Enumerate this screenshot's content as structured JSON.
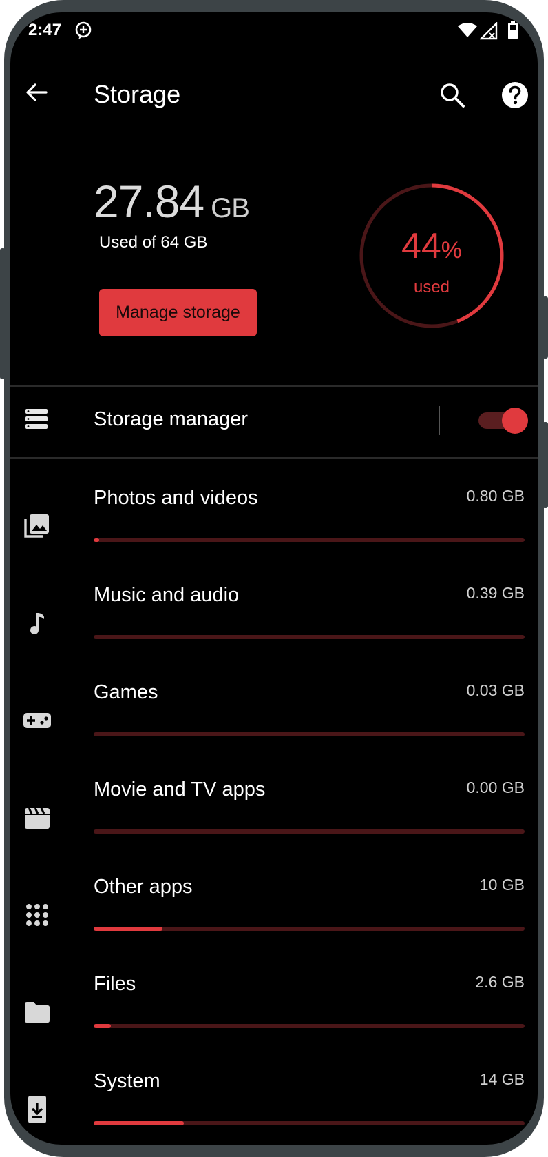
{
  "status_bar": {
    "time": "2:47"
  },
  "app_bar": {
    "title": "Storage"
  },
  "summary": {
    "used_value": "27.84",
    "used_unit": "GB",
    "used_of": "Used of 64 GB",
    "manage_button": "Manage storage",
    "percent_value": "44",
    "percent_symbol": "%",
    "percent_label": "used",
    "percent_fraction": 0.44
  },
  "storage_manager": {
    "label": "Storage manager",
    "enabled": true
  },
  "categories": [
    {
      "label": "Photos and videos",
      "size": "0.80 GB",
      "icon": "photos-icon",
      "fraction": 0.012
    },
    {
      "label": "Music and audio",
      "size": "0.39 GB",
      "icon": "music-note-icon",
      "fraction": 0.0
    },
    {
      "label": "Games",
      "size": "0.03 GB",
      "icon": "gamepad-icon",
      "fraction": 0.0
    },
    {
      "label": "Movie and TV apps",
      "size": "0.00 GB",
      "icon": "movie-clapper-icon",
      "fraction": 0.0
    },
    {
      "label": "Other apps",
      "size": "10 GB",
      "icon": "apps-grid-icon",
      "fraction": 0.16
    },
    {
      "label": "Files",
      "size": "2.6 GB",
      "icon": "folder-icon",
      "fraction": 0.04
    },
    {
      "label": "System",
      "size": "14 GB",
      "icon": "system-download-icon",
      "fraction": 0.21
    }
  ],
  "colors": {
    "accent": "#e03a3e",
    "track": "#4a1618",
    "background": "#000000",
    "frame": "#3d4447"
  }
}
